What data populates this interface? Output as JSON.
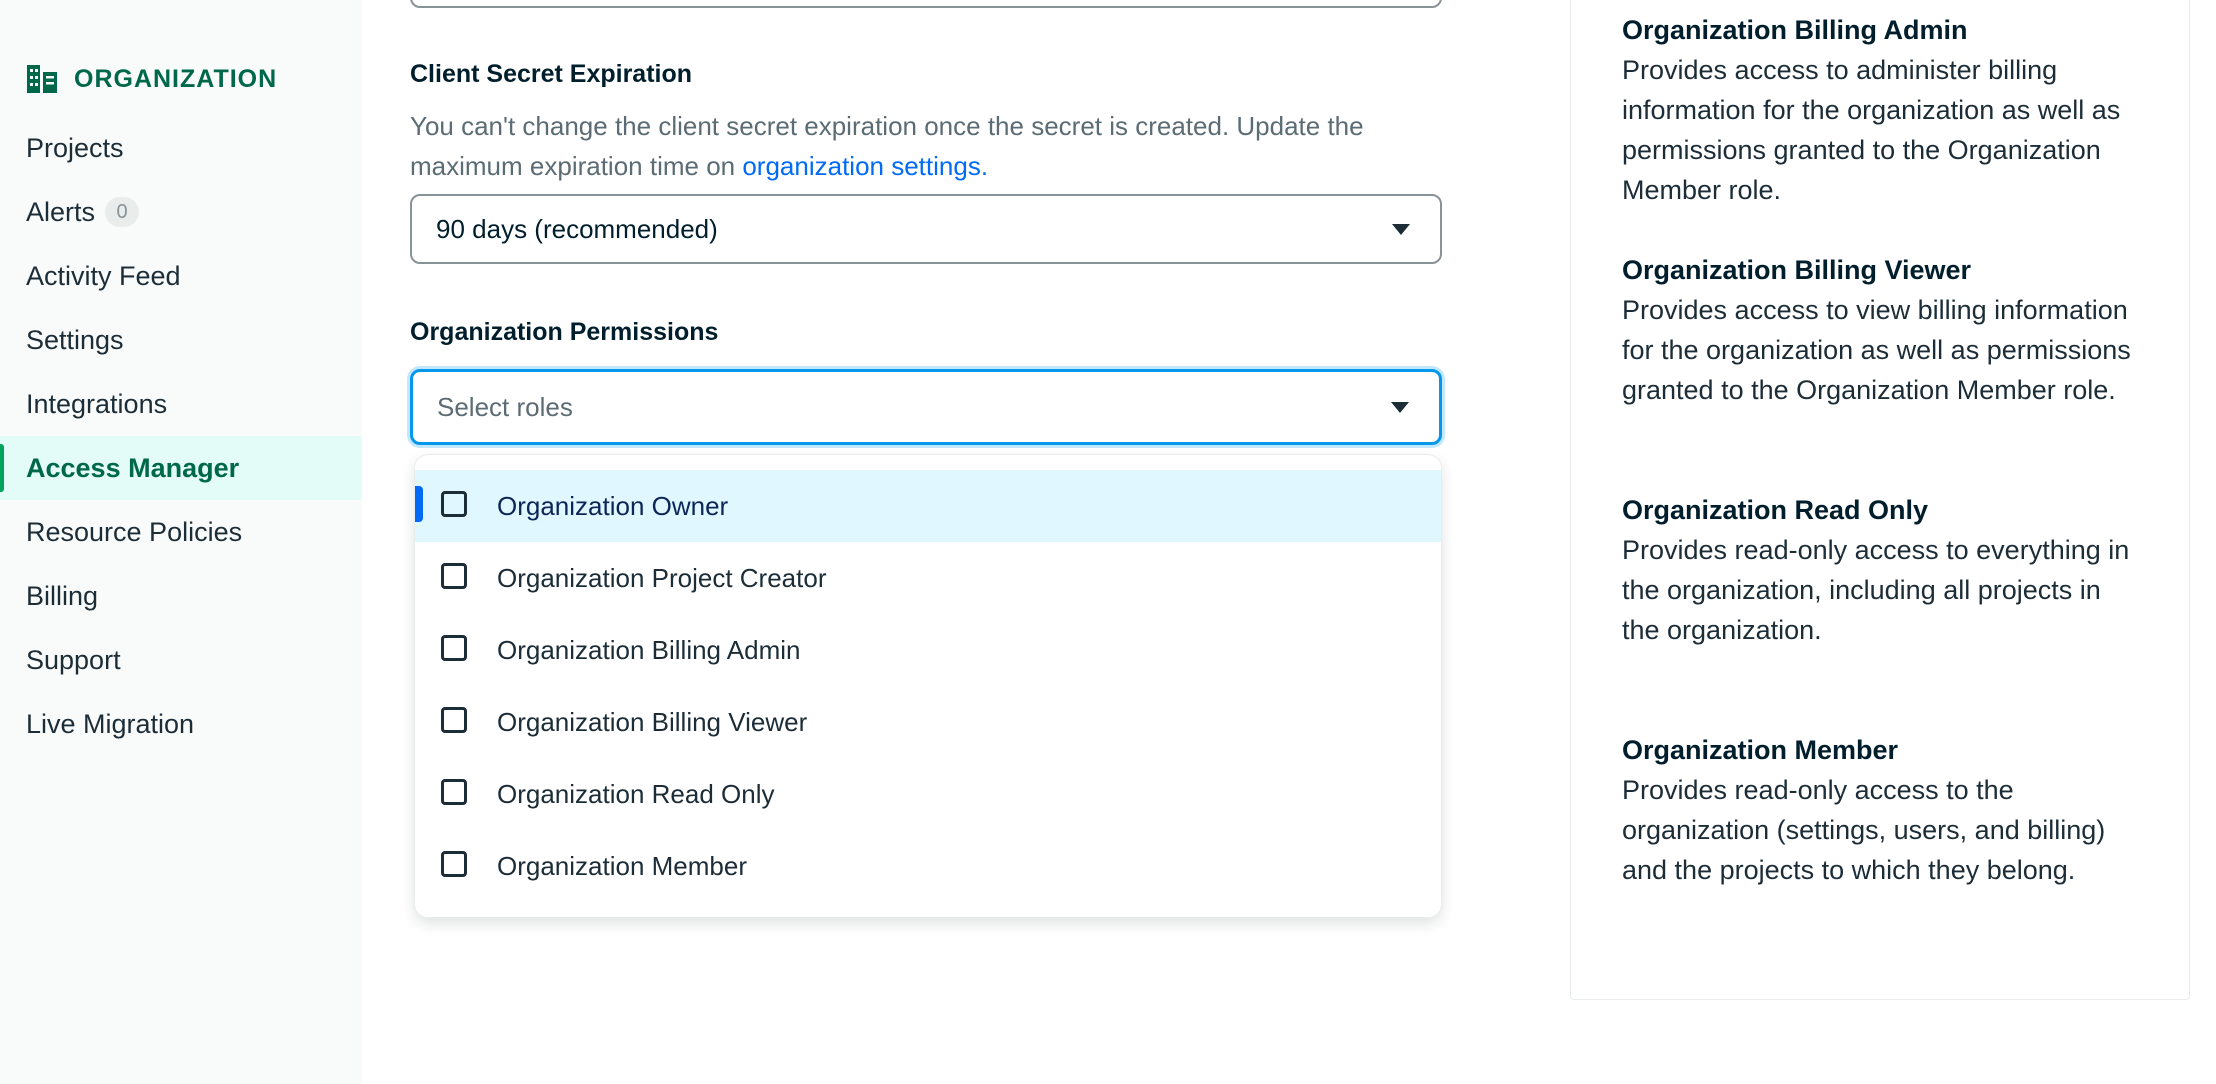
{
  "sidebar": {
    "org_label": "ORGANIZATION",
    "items": [
      {
        "label": "Projects"
      },
      {
        "label": "Alerts",
        "badge": "0"
      },
      {
        "label": "Activity Feed"
      },
      {
        "label": "Settings"
      },
      {
        "label": "Integrations"
      },
      {
        "label": "Access Manager",
        "active": true
      },
      {
        "label": "Resource Policies"
      },
      {
        "label": "Billing"
      },
      {
        "label": "Support"
      },
      {
        "label": "Live Migration"
      }
    ]
  },
  "form": {
    "secret_expiration": {
      "label": "Client Secret Expiration",
      "description": "You can't change the client secret expiration once the secret is created. Update the maximum expiration time on ",
      "link": "organization settings.",
      "value": "90 days (recommended)"
    },
    "permissions": {
      "label": "Organization Permissions",
      "placeholder": "Select roles",
      "options": [
        {
          "label": "Organization Owner",
          "checked": false,
          "highlighted": true
        },
        {
          "label": "Organization Project Creator",
          "checked": false
        },
        {
          "label": "Organization Billing Admin",
          "checked": false
        },
        {
          "label": "Organization Billing Viewer",
          "checked": false
        },
        {
          "label": "Organization Read Only",
          "checked": false
        },
        {
          "label": "Organization Member",
          "checked": false
        }
      ]
    }
  },
  "roles_info": [
    {
      "title": "Organization Billing Admin",
      "description": "Provides access to administer billing information for the organization as well as permissions granted to the Organization Member role."
    },
    {
      "title": "Organization Billing Viewer",
      "description": "Provides access to view billing information for the organization as well as permissions granted to the Organization Member role."
    },
    {
      "title": "Organization Read Only",
      "description": "Provides read-only access to everything in the organization, including all projects in the organization."
    },
    {
      "title": "Organization Member",
      "description": "Provides read-only access to the organization (settings, users, and billing) and the projects to which they belong."
    }
  ],
  "colors": {
    "brand_green": "#00684a",
    "active_bg": "#e3fcf7",
    "focus_blue": "#0498ec",
    "highlight_bg": "#e1f7ff",
    "link_blue": "#016bf8"
  },
  "icons": {
    "org": "building-icon",
    "caret": "caret-down-icon",
    "checkbox": "checkbox-icon"
  }
}
